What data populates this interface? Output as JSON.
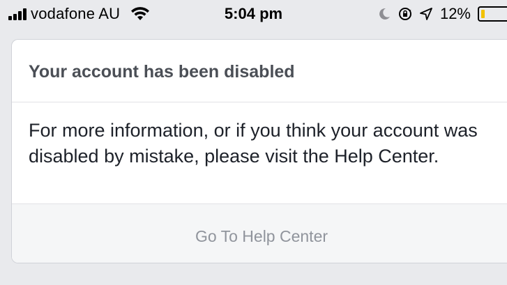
{
  "status_bar": {
    "carrier": "vodafone AU",
    "time": "5:04 pm",
    "battery_percent": "12%",
    "battery_level": 0.12,
    "icons": [
      "signal-icon",
      "wifi-icon",
      "moon-icon",
      "rotation-lock-icon",
      "location-arrow-icon",
      "battery-icon"
    ],
    "battery_color": "#f2c200"
  },
  "dialog": {
    "title": "Your account has been disabled",
    "message": "For more information, or if you think your account was disabled by mistake, please visit the Help Center.",
    "button_label": "Go To Help Center"
  },
  "colors": {
    "background": "#e9eaed",
    "title": "#4b4f56",
    "body_text": "#1d2129",
    "button_text": "#90949c",
    "footer_bg": "#f5f6f7"
  }
}
